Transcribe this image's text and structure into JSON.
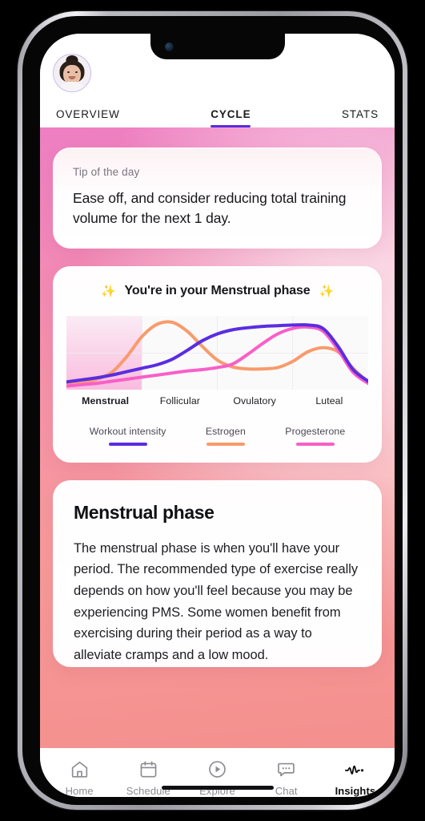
{
  "header": {
    "avatar_alt": "User profile photo",
    "tabs": [
      {
        "label": "OVERVIEW",
        "active": false
      },
      {
        "label": "CYCLE",
        "active": true
      },
      {
        "label": "STATS",
        "active": false
      }
    ]
  },
  "tip_card": {
    "label": "Tip of the day",
    "text": "Ease off, and consider reducing total training volume for the next 1 day."
  },
  "chart_card": {
    "sparkle_left": "✨",
    "sparkle_right": "✨",
    "heading": "You're in your Menstrual phase"
  },
  "info_card": {
    "title": "Menstrual phase",
    "body": "The menstrual phase is when you'll have your period. The recommended type of exercise really depends on how you'll feel because you may be experiencing PMS. Some women benefit from exercising during their period as a way to alleviate cramps and a low mood."
  },
  "bottom_nav": [
    {
      "label": "Home",
      "icon": "home-icon",
      "active": false
    },
    {
      "label": "Schedule",
      "icon": "calendar-icon",
      "active": false
    },
    {
      "label": "Explore",
      "icon": "play-circle-icon",
      "active": false
    },
    {
      "label": "Chat",
      "icon": "chat-bubble-icon",
      "active": false
    },
    {
      "label": "Insights",
      "icon": "pulse-icon",
      "active": true
    }
  ],
  "colors": {
    "accent_purple": "#5a2de0",
    "estrogen_orange": "#f89b6c",
    "progesterone_pink": "#f95fc8",
    "gradient_top": "#ee7fc2",
    "gradient_bottom": "#f4908e",
    "highlight_band": "#f9b9dd"
  },
  "chart_data": {
    "type": "line",
    "title": "Menstrual cycle hormone and workout intensity curves",
    "xlabel": "",
    "ylabel": "",
    "grid": true,
    "legend_position": "bottom",
    "categories": [
      "Menstrual",
      "Follicular",
      "Ovulatory",
      "Luteal"
    ],
    "current_category": "Menstrual",
    "highlight_band": {
      "from": 0.0,
      "to": 0.25,
      "label": "Menstrual"
    },
    "x": [
      0,
      5,
      10,
      15,
      20,
      25,
      30,
      35,
      40,
      45,
      50,
      55,
      60,
      65,
      70,
      75,
      80,
      85,
      90,
      95,
      100
    ],
    "xlim": [
      0,
      100
    ],
    "ylim": [
      0,
      100
    ],
    "series": [
      {
        "name": "Workout intensity",
        "color": "#5a2de0",
        "values": [
          8,
          11,
          14,
          18,
          23,
          28,
          33,
          41,
          54,
          68,
          78,
          84,
          87,
          89,
          90,
          91,
          91,
          86,
          60,
          26,
          9
        ]
      },
      {
        "name": "Estrogen",
        "color": "#f89b6c",
        "values": [
          4,
          7,
          12,
          22,
          45,
          74,
          92,
          95,
          82,
          60,
          40,
          30,
          27,
          27,
          29,
          38,
          52,
          58,
          52,
          28,
          7
        ]
      },
      {
        "name": "Progesterone",
        "color": "#f95fc8",
        "values": [
          2,
          4,
          6,
          9,
          12,
          15,
          18,
          21,
          24,
          26,
          29,
          34,
          48,
          64,
          78,
          86,
          88,
          82,
          55,
          22,
          6
        ]
      }
    ]
  }
}
